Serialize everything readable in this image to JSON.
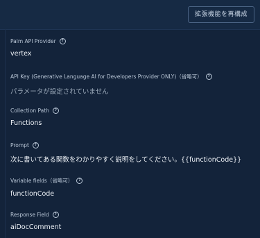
{
  "header": {
    "reconfigure_button": "拡張機能を再構成"
  },
  "fields": [
    {
      "label": "Palm API Provider",
      "value": "vertex",
      "help_icon": "help-circle-icon"
    },
    {
      "label": "API Key (Generative Language AI for Developers Provider ONLY)（省略可）",
      "value": "パラメータが設定されていません",
      "help_icon": "help-circle-icon"
    },
    {
      "label": "Collection Path",
      "value": "Functions",
      "help_icon": "help-circle-icon"
    },
    {
      "label": "Prompt",
      "value": "次に書いてある関数をわかりやすく説明をしてください。{{functionCode}}",
      "help_icon": "help-circle-icon"
    },
    {
      "label": "Variable fields（省略可）",
      "value": "functionCode",
      "help_icon": "help-circle-icon"
    },
    {
      "label": "Response Field",
      "value": "aiDocComment",
      "help_icon": "help-circle-icon"
    }
  ]
}
